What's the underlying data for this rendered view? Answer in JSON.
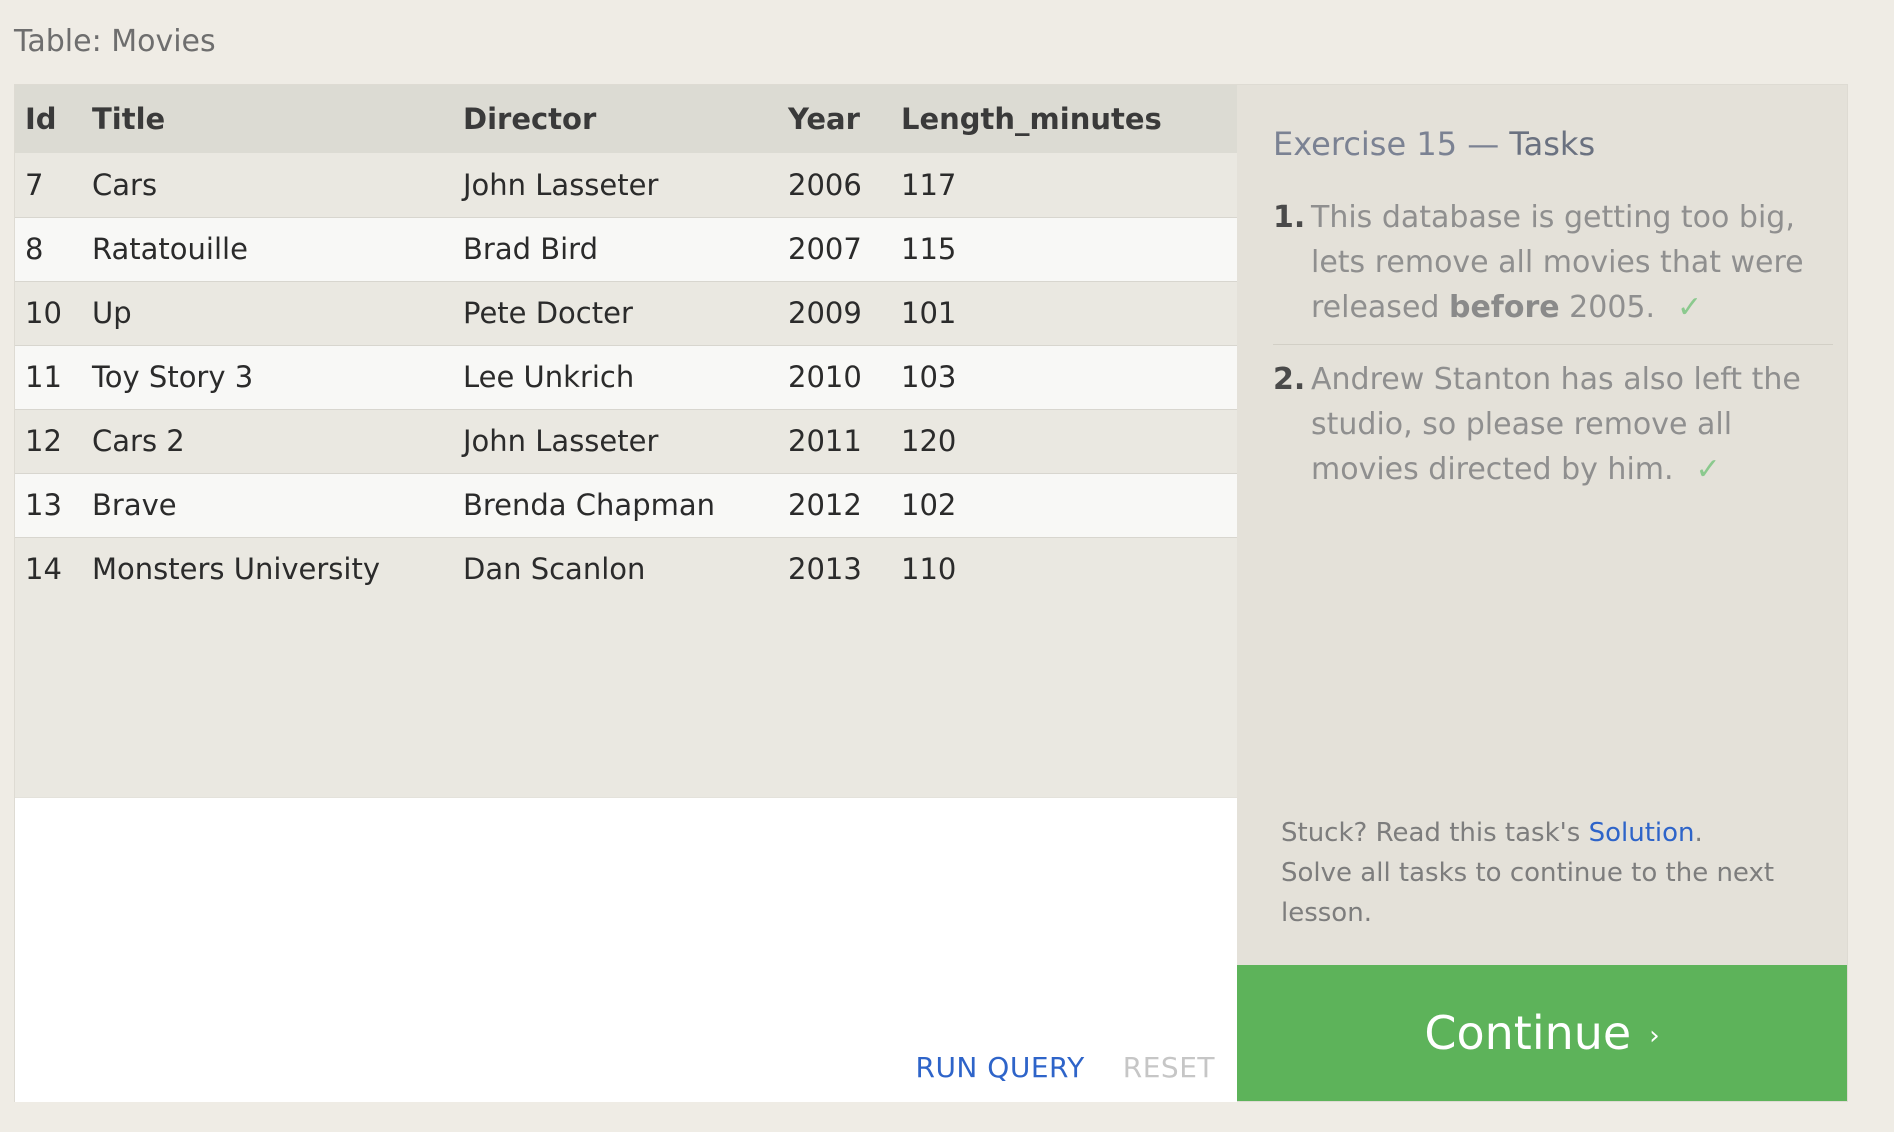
{
  "table": {
    "label": "Table: Movies",
    "columns": [
      "Id",
      "Title",
      "Director",
      "Year",
      "Length_minutes"
    ],
    "rows": [
      [
        "7",
        "Cars",
        "John Lasseter",
        "2006",
        "117"
      ],
      [
        "8",
        "Ratatouille",
        "Brad Bird",
        "2007",
        "115"
      ],
      [
        "10",
        "Up",
        "Pete Docter",
        "2009",
        "101"
      ],
      [
        "11",
        "Toy Story 3",
        "Lee Unkrich",
        "2010",
        "103"
      ],
      [
        "12",
        "Cars 2",
        "John Lasseter",
        "2011",
        "120"
      ],
      [
        "13",
        "Brave",
        "Brenda Chapman",
        "2012",
        "102"
      ],
      [
        "14",
        "Monsters University",
        "Dan Scanlon",
        "2013",
        "110"
      ]
    ]
  },
  "editor": {
    "run_label": "RUN QUERY",
    "reset_label": "RESET"
  },
  "exercise": {
    "heading_prefix": "Exercise 15 —",
    "heading_tasks": "Tasks",
    "tasks": [
      {
        "number": "1.",
        "text_before": "This database is getting too big, lets remove all movies that were released ",
        "bold": "before",
        "text_after": " 2005.",
        "check": "✓"
      },
      {
        "number": "2.",
        "text": "Andrew Stanton has also left the studio, so please remove all movies directed by him.",
        "check": "✓"
      }
    ],
    "help_prefix": "Stuck? Read this task's ",
    "help_link": "Solution",
    "help_suffix": ".",
    "help_line2": "Solve all tasks to continue to the next lesson.",
    "continue_label": "Continue",
    "continue_icon": "›"
  },
  "colors": {
    "continue_bg": "#5db35a",
    "link": "#2e64c9",
    "check": "#8bc98e"
  }
}
